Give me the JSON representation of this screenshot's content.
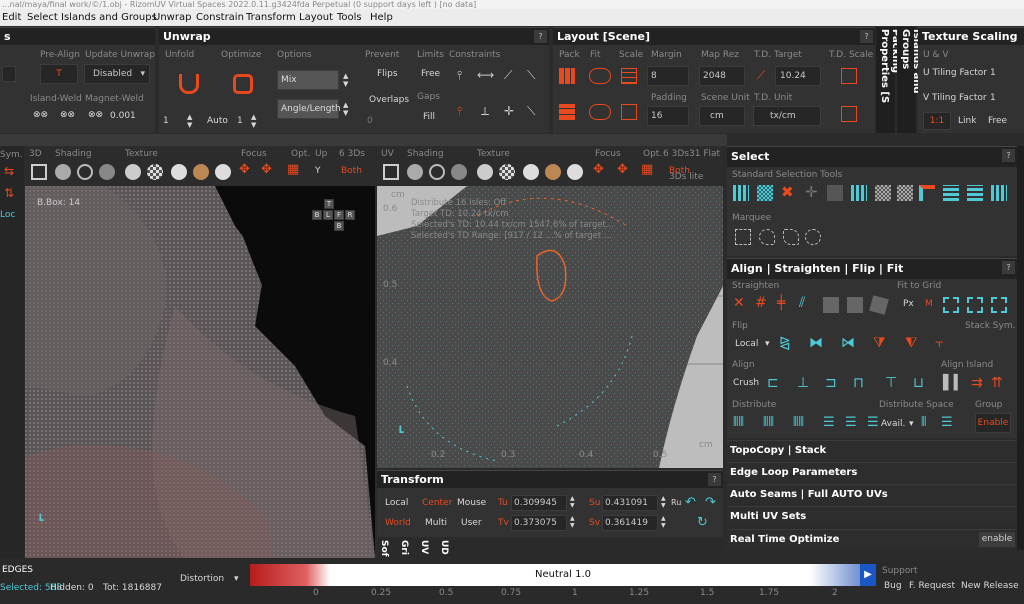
{
  "title_text": "...nal/maya/final work/©/1.obj - RizomUV  Virtual Spaces 2022.0.11.g3424fda Perpetual  (0 support days left ) [no data]",
  "menu": [
    "Edit",
    "Select",
    "Islands and Groups",
    "Unwrap",
    "Constrain",
    "Transform",
    "Layout",
    "Tools",
    "Help"
  ],
  "left_stub": {
    "s": "s",
    "pre_align": "Pre-Align",
    "update_unwrap": "Update Unwrap",
    "t": "T",
    "disabled": "Disabled",
    "island_weld": "Island-Weld",
    "magnet_weld": "Magnet-Weld",
    "weld_val": "0.001"
  },
  "unwrap": {
    "title": "Unwrap",
    "q": "?",
    "unfold": "Unfold",
    "optimize": "Optimize",
    "options": "Options",
    "mix": "Mix",
    "angle_length": "Angle/Length",
    "prevent": "Prevent",
    "flips": "Flips",
    "overlaps": "Overlaps",
    "limits": "Limits",
    "free": "Free",
    "gaps": "Gaps",
    "fill": "Fill",
    "constraints": "Constraints",
    "one": "1",
    "auto": "Auto",
    "one2": "1",
    "zero": "0"
  },
  "layout": {
    "title": "Layout [Scene]",
    "q": "?",
    "pack": "Pack",
    "fit": "Fit",
    "scale": "Scale",
    "margin": "Margin",
    "margin_val": "8",
    "map_rez": "Map Rez",
    "map_rez_val": "2048",
    "td_target": "T.D. Target",
    "td_target_val": "10.24",
    "td_scale": "T.D. Scale",
    "padding": "Padding",
    "padding_val": "16",
    "scene_unit": "Scene Unit",
    "scene_unit_val": "cm",
    "td_unit": "T.D. Unit",
    "td_unit_val": "tx/cm"
  },
  "packing_props": "Packing Properties [S",
  "islands_groups": "Islands and Groups",
  "texture_scaling": {
    "title": "Texture Scaling",
    "uv": "U & V",
    "u_tiling": "U Tiling Factor",
    "u_val": "1",
    "v_tiling": "V Tiling Factor",
    "v_val": "1",
    "ratio": "1:1",
    "link": "Link",
    "free": "Free"
  },
  "left_strip": {
    "sym": "Sym.",
    "loc": "Loc"
  },
  "vp3d": {
    "label_3d": "3D",
    "shading": "Shading",
    "texture": "Texture",
    "focus": "Focus",
    "opt": "Opt.",
    "up": "Up",
    "views": "6 3Ds",
    "y": "Y",
    "both": "Both",
    "bbox": "B.Box: 14",
    "cube": [
      "T",
      "B",
      "L",
      "F",
      "R",
      "B"
    ]
  },
  "vpuv": {
    "uv": "UV",
    "shading": "Shading",
    "texture": "Texture",
    "focus": "Focus",
    "opt": "Opt.",
    "views": "6 3Ds",
    "flat": "31 Flat",
    "both": "Both",
    "tds_lite": "3Ds lite",
    "q": "?",
    "cm": "cm",
    "cm2": "cm",
    "info": [
      "Distribute 16 Isles: Off",
      "Target TD: 10.24 tx/cm",
      "Selected's TD: 10.44 tx/cm  1547.6% of target...",
      "Selected's TD Range: [917 / 12 ...% of target ..."
    ],
    "yticks": [
      "0.6",
      "0.5",
      "0.4"
    ],
    "xticks": [
      "0.2",
      "0.3",
      "0.4",
      "0.5"
    ]
  },
  "transform": {
    "title": "Transform",
    "q": "?",
    "local": "Local",
    "center": "Center",
    "mouse": "Mouse",
    "world": "World",
    "multi": "Multi",
    "user": "User",
    "tu": "Tu",
    "tu_val": "0.309945",
    "tv": "Tv",
    "tv_val": "0.373075",
    "su": "Su",
    "su_val": "0.431091",
    "sv": "Sv",
    "sv_val": "0.361419",
    "ru": "Ru"
  },
  "bottom_tabs": [
    "Sof",
    "Gri",
    "UV",
    "UD"
  ],
  "select": {
    "title": "Select",
    "q": "?",
    "std": "Standard Selection Tools",
    "marquee": "Marquee"
  },
  "align": {
    "title": "Align | Straighten | Flip | Fit",
    "q": "?",
    "straighten": "Straighten",
    "fit_grid": "Fit to Grid",
    "px": "Px",
    "m": "M",
    "flip": "Flip",
    "stack_sym": "Stack Sym.",
    "local": "Local",
    "align": "Align",
    "align_island": "Align Island",
    "crush": "Crush",
    "distribute": "Distribute",
    "dist_space": "Distribute Space",
    "group": "Group",
    "avail": "Avail.",
    "enable": "Enable"
  },
  "sections": [
    "TopoCopy | Stack",
    "Edge Loop Parameters",
    "Auto Seams | Full AUTO UVs",
    "Multi UV Sets",
    "Real Time Optimize"
  ],
  "rto_enable": "enable",
  "status": {
    "edges": "EDGES",
    "selected": "Selected: 588",
    "hidden": "Hidden: 0",
    "tot": "Tot: 1816887",
    "distortion": "Distortion",
    "neutral": "Neutral 1.0",
    "ticks": [
      "0",
      "0.25",
      "0.5",
      "0.75",
      "1",
      "1.25",
      "1.5",
      "1.75",
      "2"
    ],
    "support": "Support",
    "bug": "Bug",
    "f_request": "F. Request",
    "new_release": "New Release"
  },
  "colors": {
    "accent": "#e84a1e",
    "panel": "#323232",
    "header": "#222222",
    "cyan": "#4ec9d6"
  }
}
